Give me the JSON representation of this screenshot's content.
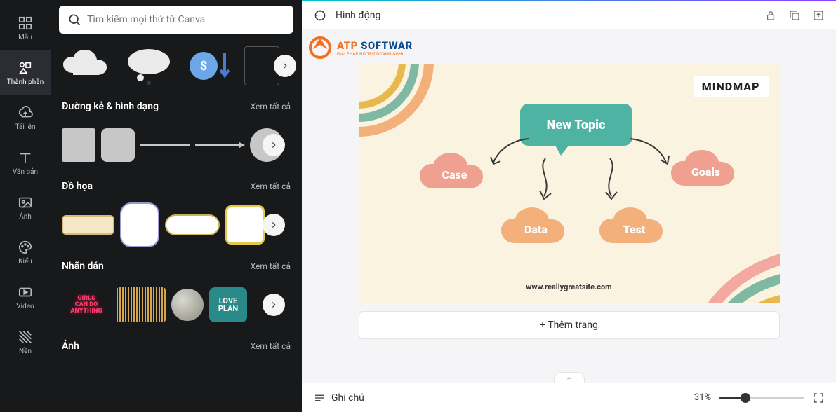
{
  "nav": {
    "mau": "Mẫu",
    "thanhphan": "Thành phần",
    "tailen": "Tải lên",
    "vanban": "Văn bản",
    "anh": "Ảnh",
    "kieu": "Kiểu",
    "video": "Video",
    "nen": "Nền"
  },
  "search": {
    "placeholder": "Tìm kiếm mọi thứ từ Canva"
  },
  "sections": {
    "lines": {
      "title": "Đường kẻ & hình dạng",
      "see_all": "Xem tất cả"
    },
    "graphics": {
      "title": "Đồ họa",
      "see_all": "Xem tất cả"
    },
    "stickers": {
      "title": "Nhãn dán",
      "see_all": "Xem tất cả"
    },
    "photos": {
      "title": "Ảnh",
      "see_all": "Xem tất cả"
    },
    "sticker_girls": "GIRLS\nCAN DO\nANYTHING",
    "sticker_love": "LOVE\nPLAN"
  },
  "toolbar": {
    "animation": "Hình động"
  },
  "logo": {
    "brand_a": "ATP ",
    "brand_b": "SOFTWAR",
    "tagline": "GIẢI PHÁP HỖ TRỢ DOANH NGHI"
  },
  "design": {
    "mindmap": "MINDMAP",
    "topic": "New Topic",
    "case": "Case",
    "goals": "Goals",
    "data": "Data",
    "test": "Test",
    "url": "www.reallygreatsite.com"
  },
  "canvas": {
    "add_page": "+ Thêm trang"
  },
  "footer": {
    "notes": "Ghi chú",
    "zoom": "31%"
  }
}
